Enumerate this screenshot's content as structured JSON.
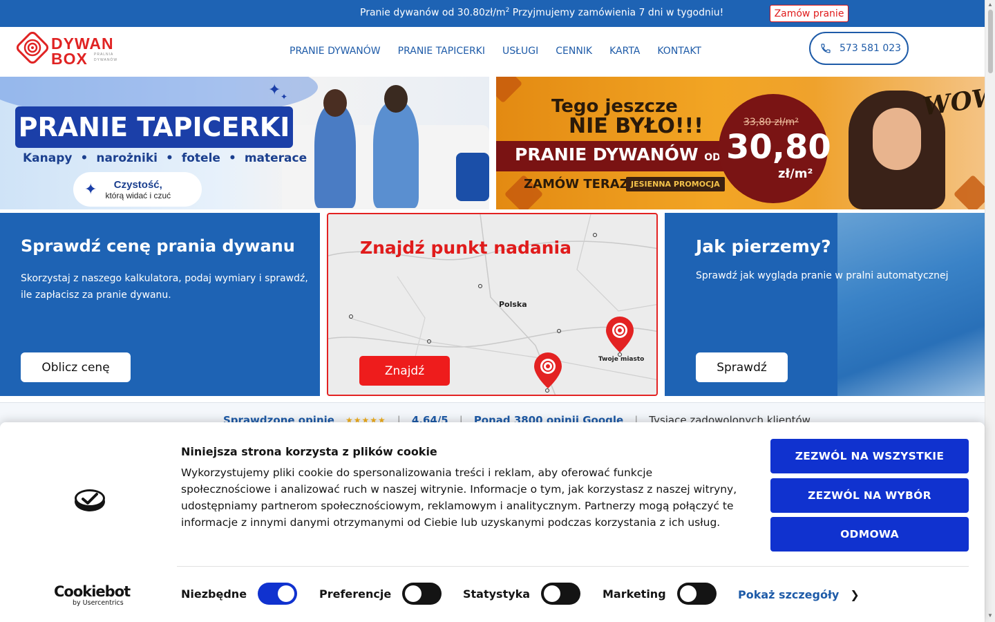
{
  "topbar": {
    "promo_text": "Pranie dywanów od 30.80zł/m",
    "promo_sup": "2",
    "promo_text2": " Przyjmujemy zamówienia 7 dni w tygodniu!",
    "order_button": "Zamów pranie"
  },
  "header": {
    "logo": {
      "word1": "DYWAN",
      "word2": "BOX",
      "tag1": "PRALNIA",
      "tag2": "DYWANÓW"
    },
    "nav": [
      "PRANIE DYWANÓW",
      "PRANIE TAPICERKI",
      "USŁUGI",
      "CENNIK",
      "KARTA",
      "KONTAKT"
    ],
    "phone": "573 581 023"
  },
  "banner_left": {
    "title": "PRANIE TAPICERKI",
    "features": [
      "Kanapy",
      "narożniki",
      "fotele",
      "materace"
    ],
    "pill_title": "Czystość,",
    "pill_sub": "którą widać i czuć"
  },
  "banner_right": {
    "line1": "Tego jeszcze",
    "line2": "NIE BYŁO!!!",
    "pranie": "PRANIE DYWANÓW",
    "pranie_od": "OD",
    "zamow": "ZAMÓW TERAZ",
    "promo_tag": "JESIENNA PROMOCJA",
    "old_price": "33,80 zł/m²",
    "price": "30,80",
    "unit": "zł/m²",
    "wow": "WOW!"
  },
  "cards": {
    "price_card": {
      "title": "Sprawdź cenę prania dywanu",
      "text": "Skorzystaj z naszego kalkulatora, podaj wymiary i sprawdź, ile zapłacisz za pranie dywanu.",
      "button": "Oblicz cenę"
    },
    "map_card": {
      "title": "Znajdź punkt nadania",
      "label_country": "Polska",
      "label_city": "Twoje miasto",
      "button": "Znajdź"
    },
    "how_card": {
      "title": "Jak pierzemy?",
      "text": "Sprawdź jak wygląda pranie w pralni automatycznej",
      "button": "Sprawdź"
    }
  },
  "ratings": {
    "verified": "Sprawdzone opinie",
    "stars": "★★★★★",
    "score": "4.64/5",
    "google": "Ponad 3800 opinii Google",
    "happy": "Tysiące zadowolonych klientów",
    "separator": "|"
  },
  "cookie": {
    "title": "Niniejsza strona korzysta z plików cookie",
    "text": "Wykorzystujemy pliki cookie do spersonalizowania treści i reklam, aby oferować funkcje społecznościowe i analizować ruch w naszej witrynie. Informacje o tym, jak korzystasz z naszej witryny, udostępniamy partnerom społecznościowym, reklamowym i analitycznym. Partnerzy mogą połączyć te informacje z innymi danymi otrzymanymi od Ciebie lub uzyskanymi podczas korzystania z ich usług.",
    "buttons": [
      "ZEZWÓL NA WSZYSTKIE",
      "ZEZWÓL NA WYBÓR",
      "ODMOWA"
    ],
    "brand": "Cookiebot",
    "brand_by": "by Usercentrics",
    "toggles": [
      {
        "label": "Niezbędne",
        "checked": true
      },
      {
        "label": "Preferencje",
        "checked": false
      },
      {
        "label": "Statystyka",
        "checked": false
      },
      {
        "label": "Marketing",
        "checked": false
      }
    ],
    "details": "Pokaż szczegóły"
  },
  "colors": {
    "primary_blue": "#1e63b4",
    "accent_red": "#e01b1b",
    "cookie_blue": "#1032cf"
  }
}
